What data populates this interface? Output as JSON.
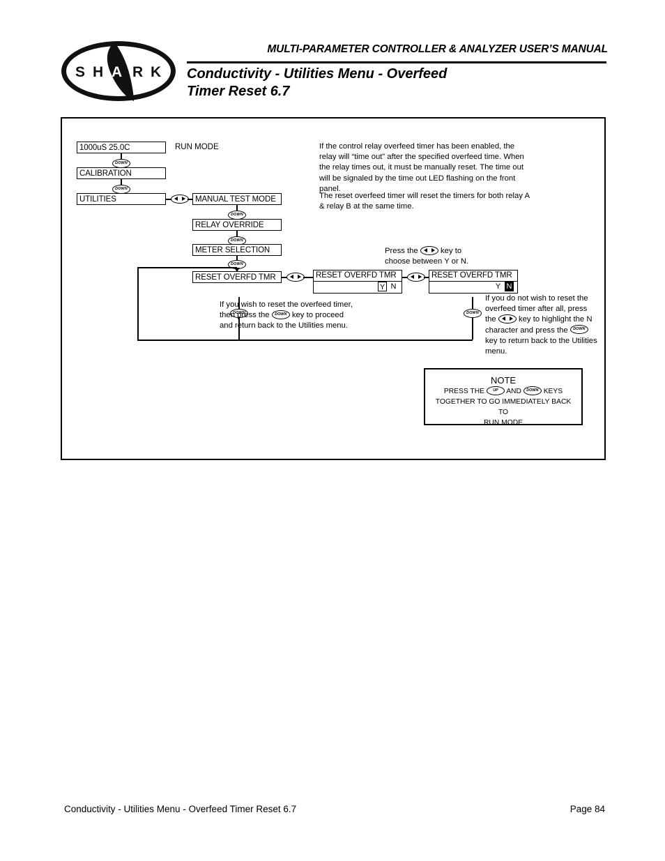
{
  "header": {
    "manual_title": "MULTI-PARAMETER CONTROLLER & ANALYZER USER’S MANUAL",
    "page_heading_line1": "Conductivity - Utilities Menu - Overfeed",
    "page_heading_line2": "Timer Reset 6.7",
    "logo_letters": [
      "S",
      "H",
      "A",
      "R",
      "K"
    ]
  },
  "diagram": {
    "menu_boxes": {
      "run_display": "1000uS  25.0C",
      "run_mode_label": "RUN MODE",
      "calibration": "CALIBRATION",
      "utilities": "UTILITIES",
      "manual_test_mode": "MANUAL TEST MODE",
      "relay_override": "RELAY OVERRIDE",
      "meter_selection": "METER SELECTION",
      "reset_overfd_tmr": "RESET OVERFD TMR"
    },
    "lcd_left": {
      "title": "RESET OVERFD TMR",
      "option_y": "Y",
      "option_n": "N",
      "selected": "Y"
    },
    "lcd_right": {
      "title": "RESET OVERFD TMR",
      "option_y": "Y",
      "option_n": "N",
      "selected": "N"
    },
    "keys": {
      "down_label": "DOWN",
      "up_label": "UP",
      "leftright_label": "left-right"
    },
    "description": {
      "paragraph1": "If the control relay overfeed timer has been enabled, the relay will “time out” after the specified overfeed time. When the relay times out, it must be manually reset. The time out will be signaled by the time out LED flashing on the front panel.",
      "paragraph2": "The reset overfeed timer will reset the timers for both relay A & relay B at the same time."
    },
    "press_key_note": {
      "before": "Press the",
      "after": "key to",
      "line2": "choose between Y or N."
    },
    "left_instruction": {
      "line1": "If you wish to reset the overfeed timer,",
      "line2_before": "then press the",
      "line2_after": "key to  proceed",
      "line3": "and return back to the Utilities menu."
    },
    "right_instruction": {
      "line1": "If you do not wish to reset the",
      "line2": "overfeed timer after all, press",
      "line3_before": "the",
      "line3_after": "key to highlight the N",
      "line4_before": "character and press the",
      "line5": "key to return back to the Utilities",
      "line6": "menu."
    }
  },
  "note": {
    "title": "NOTE",
    "line1_a": "PRESS THE",
    "line1_b": "AND",
    "line1_c": "KEYS",
    "line2": "TOGETHER TO GO IMMEDIATELY BACK TO",
    "line3": "RUN MODE"
  },
  "footer": {
    "left": "Conductivity - Utilities Menu - Overfeed Timer Reset 6.7",
    "right": "Page 84"
  }
}
